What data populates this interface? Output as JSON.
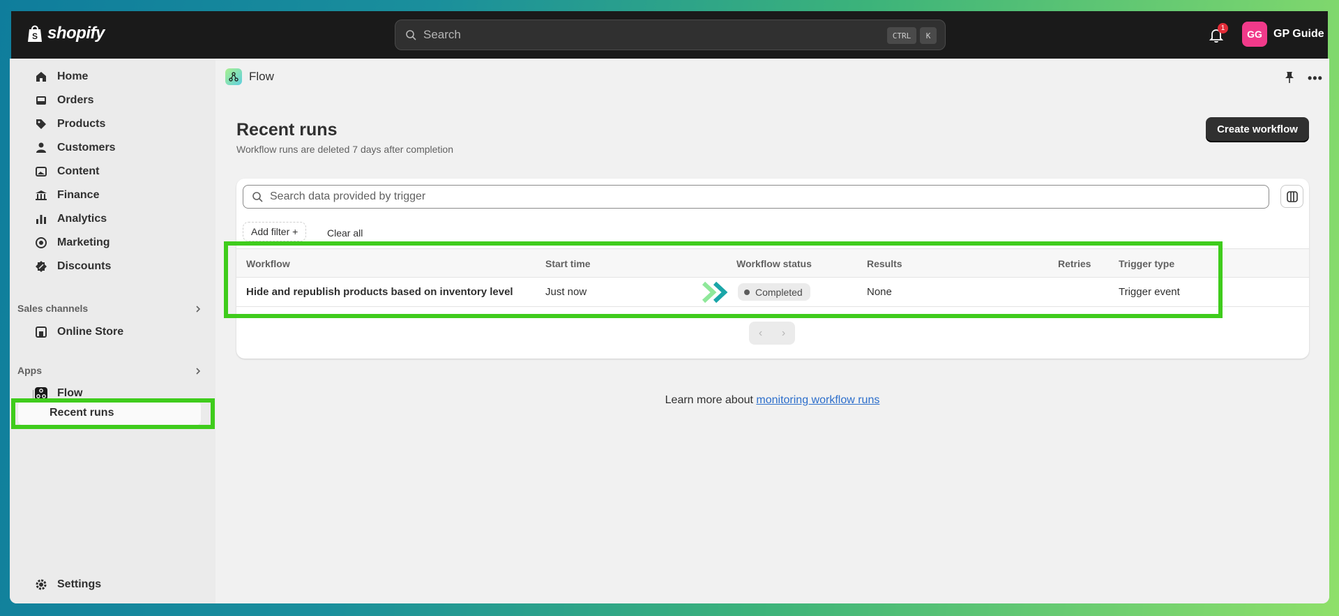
{
  "topbar": {
    "brand": "shopify",
    "search_placeholder": "Search",
    "shortcut_ctrl": "CTRL",
    "shortcut_k": "K",
    "notification_count": "1",
    "avatar_initials": "GG",
    "account_name": "GP Guide"
  },
  "sidebar": {
    "items": [
      {
        "label": "Home",
        "icon": "home-icon"
      },
      {
        "label": "Orders",
        "icon": "inbox-icon"
      },
      {
        "label": "Products",
        "icon": "tag-icon"
      },
      {
        "label": "Customers",
        "icon": "person-icon"
      },
      {
        "label": "Content",
        "icon": "image-icon"
      },
      {
        "label": "Finance",
        "icon": "bank-icon"
      },
      {
        "label": "Analytics",
        "icon": "bar-chart-icon"
      },
      {
        "label": "Marketing",
        "icon": "target-icon"
      },
      {
        "label": "Discounts",
        "icon": "discount-icon"
      }
    ],
    "sales_channels_label": "Sales channels",
    "online_store": "Online Store",
    "apps_label": "Apps",
    "flow": "Flow",
    "recent_runs": "Recent runs",
    "settings": "Settings"
  },
  "header": {
    "app_name": "Flow"
  },
  "page": {
    "title": "Recent runs",
    "subtitle": "Workflow runs are deleted 7 days after completion",
    "create_button": "Create workflow"
  },
  "table": {
    "search_placeholder": "Search data provided by trigger",
    "add_filter": "Add filter +",
    "clear_all": "Clear all",
    "columns": {
      "workflow": "Workflow",
      "start_time": "Start time",
      "status": "Workflow status",
      "results": "Results",
      "retries": "Retries",
      "trigger_type": "Trigger type"
    },
    "rows": [
      {
        "workflow": "Hide and republish products based on inventory level",
        "start_time": "Just now",
        "status": "Completed",
        "results": "None",
        "retries": "",
        "trigger_type": "Trigger event"
      }
    ]
  },
  "footer": {
    "learn_text": "Learn more about ",
    "learn_link": "monitoring workflow runs"
  },
  "colors": {
    "highlight": "#3fcc1c",
    "topbar": "#1a1a1a",
    "primary_button": "#303030",
    "avatar": "#f13a8a",
    "link": "#2c6ecb"
  }
}
